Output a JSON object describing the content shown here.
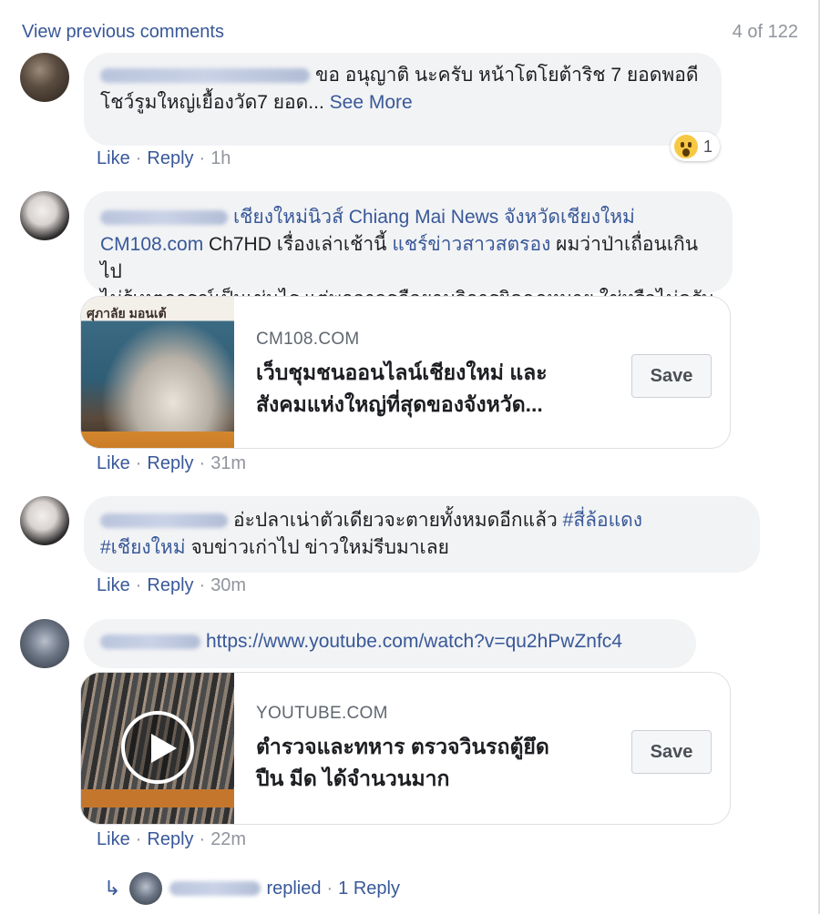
{
  "header": {
    "view_previous": "View previous comments",
    "count": "4 of 122"
  },
  "comments": [
    {
      "author": "Wanasan Sirimongkol",
      "text_line1": "ขอ อนุญาติ นะครับ หน้าโตโยต้าริช 7 ยอดพอดี",
      "text_line2": "โชว์รูมใหญ่เยื้องวัด7 ยอด...",
      "see_more": "See More",
      "like": "Like",
      "reply": "Reply",
      "time": "1h",
      "reaction": {
        "icon": "wow-reaction-icon",
        "count": "1"
      }
    },
    {
      "author": "ผู้ใช้",
      "tag1": "เชียงใหม่นิวส์ Chiang Mai News จังหวัดเชียงใหม่",
      "tag2": "CM108.com",
      "text_mid": " Ch7HD เรื่องเล่าเช้านี้ ",
      "tag3": "แชร์ข่าวสาวสตรอง",
      "text_end": " ผมว่าป่าเถื่อนเกินไป",
      "text_line3": "ไม่รู้เหตุการณ์เป็นเช่นไร แต่พกอาวุธถือยามวิการผิดกฏหมาย ใช่หรือไม่ครับ",
      "card": {
        "domain": "CM108.COM",
        "title_line1": "เว็บชุมชนออนไลน์เชียงใหม่ และ",
        "title_line2": "สังคมแห่งใหญ่ที่สุดของจังหวัด...",
        "thumb_text": "ศุภาลัย มอนเต้",
        "save": "Save"
      },
      "like": "Like",
      "reply": "Reply",
      "time": "31m"
    },
    {
      "author": "ผู้ใช้",
      "text_line1": "อ่ะปลาเน่าตัวเดียวจะตายทั้งหมดอีกแล้ว ",
      "hashtag1": "#สี่ล้อแดง",
      "hashtag2": "#เชียงใหม่",
      "text_line2": " จบข่าวเก่าไป ข่าวใหม่รีบมาเลย",
      "like": "Like",
      "reply": "Reply",
      "time": "30m"
    },
    {
      "author": "ผู้ใช้",
      "link": "https://www.youtube.com/watch?v=qu2hPwZnfc4",
      "card": {
        "domain": "YOUTUBE.COM",
        "title_line1": "ตำรวจและทหาร ตรวจวินรถตู้ยึด",
        "title_line2": "ปืน มีด ได้จำนวนมาก",
        "save": "Save"
      },
      "like": "Like",
      "reply": "Reply",
      "time": "22m",
      "replies": {
        "replied": "replied",
        "dot": "·",
        "count": "1 Reply"
      }
    }
  ]
}
